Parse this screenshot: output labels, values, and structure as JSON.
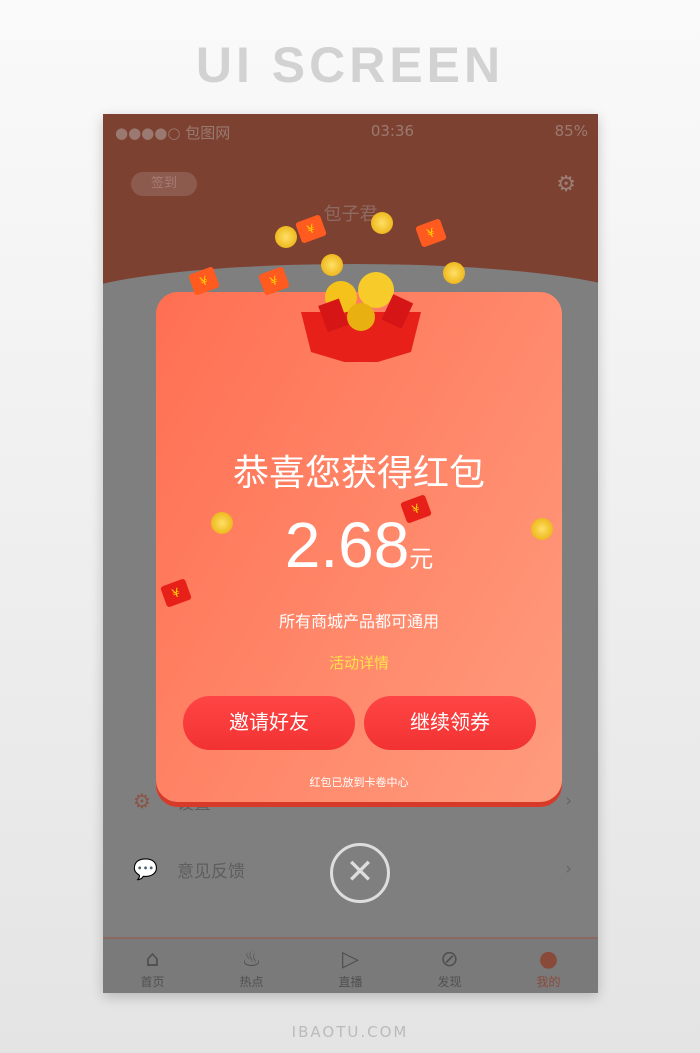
{
  "page_title": "UI SCREEN",
  "status": {
    "carrier": "●●●●○ 包图网",
    "time": "03:36",
    "battery": "85%"
  },
  "header": {
    "sign_in": "签到",
    "username": "包子君",
    "gear_icon": "gear-icon"
  },
  "menu": [
    {
      "label": "设置",
      "icon": "gear-icon"
    },
    {
      "label": "意见反馈",
      "icon": "chat-icon"
    }
  ],
  "tabs": [
    {
      "label": "首页",
      "icon": "home-icon"
    },
    {
      "label": "热点",
      "icon": "flame-icon"
    },
    {
      "label": "直播",
      "icon": "tv-icon"
    },
    {
      "label": "发现",
      "icon": "compass-icon"
    },
    {
      "label": "我的",
      "icon": "user-icon",
      "active": true
    }
  ],
  "modal": {
    "title": "恭喜您获得红包",
    "amount": "2.68",
    "unit": "元",
    "subtitle": "所有商城产品都可通用",
    "details_link": "活动详情",
    "invite_button": "邀请好友",
    "continue_button": "继续领券",
    "note": "红包已放到卡卷中心"
  },
  "watermark": "IBAOTU.COM",
  "colors": {
    "modal_start": "#ff6f52",
    "modal_end": "#ff9c7e",
    "button": "#f23232",
    "link": "#ffe14a"
  }
}
